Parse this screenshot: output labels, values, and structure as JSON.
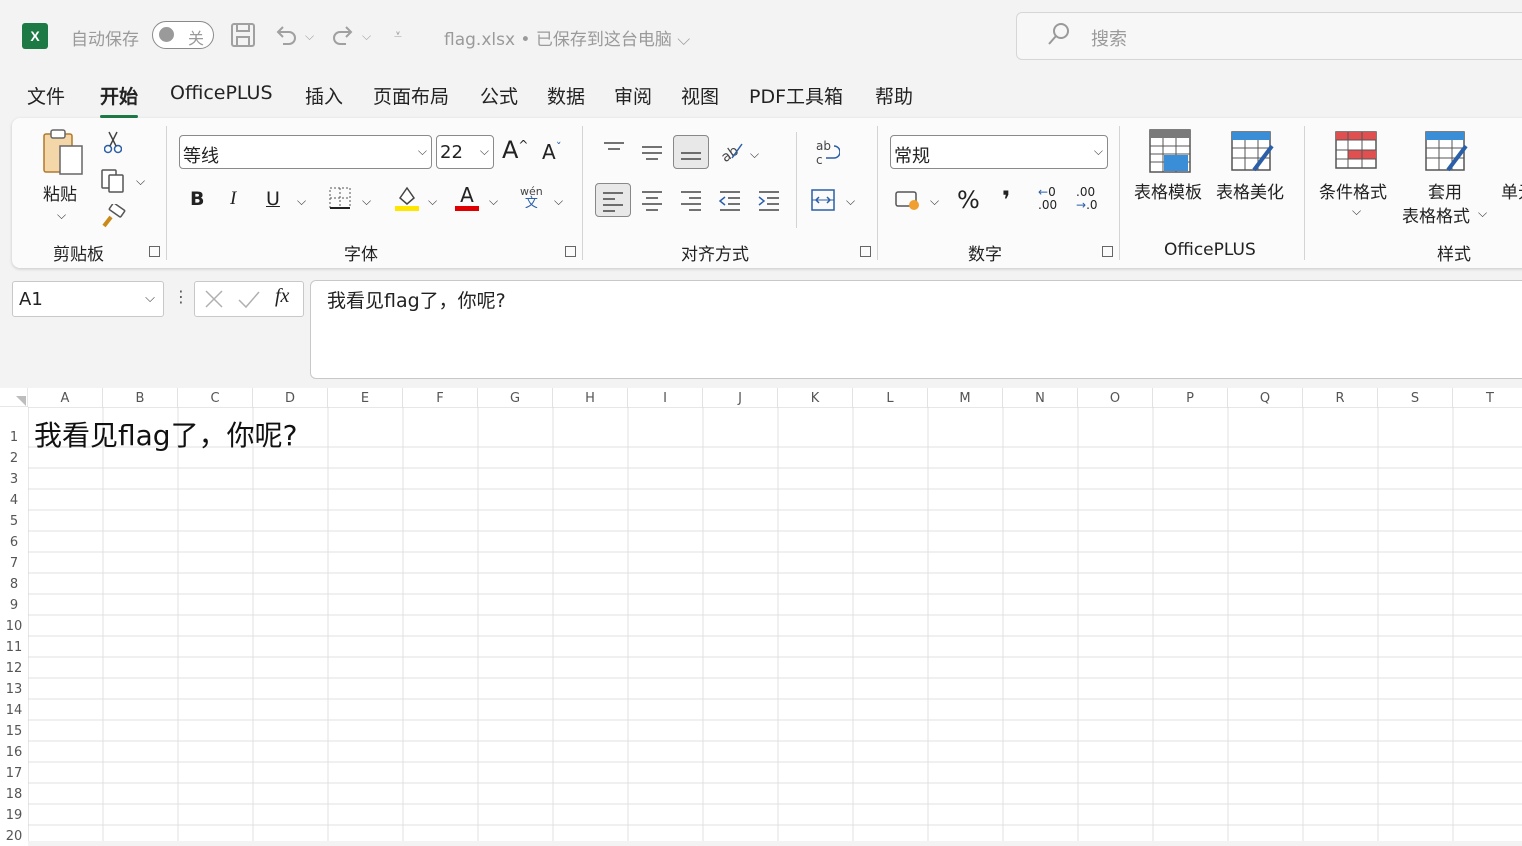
{
  "title_bar": {
    "app_logo_letter": "X",
    "autosave_label": "自动保存",
    "autosave_state": "关",
    "file_title": "flag.xlsx • 已保存到这台电脑",
    "search_placeholder": "搜索"
  },
  "tabs": [
    "文件",
    "开始",
    "OfficePLUS",
    "插入",
    "页面布局",
    "公式",
    "数据",
    "审阅",
    "视图",
    "PDF工具箱",
    "帮助"
  ],
  "active_tab": "开始",
  "ribbon": {
    "clipboard": {
      "label": "剪贴板",
      "paste_label": "粘贴"
    },
    "font": {
      "label": "字体",
      "font_name": "等线",
      "font_size": "22",
      "bold": "B",
      "italic": "I",
      "underline": "U",
      "font_color_glyph": "A",
      "phonetic_top": "wén",
      "phonetic_bottom": "文"
    },
    "alignment": {
      "label": "对齐方式"
    },
    "number": {
      "label": "数字",
      "format": "常规",
      "percent": "%",
      "comma": "❜",
      "inc_decimal": ".00",
      "dec_decimal": ".00"
    },
    "officeplus": {
      "label": "OfficePLUS",
      "table_template": "表格模板",
      "table_beautify": "表格美化"
    },
    "styles": {
      "label": "样式",
      "conditional_format": "条件格式",
      "apply_line1": "套用",
      "apply_line2": "表格格式",
      "cell_style": "单元"
    }
  },
  "formula_bar": {
    "name_box": "A1",
    "fx": "fx",
    "content": "我看见flag了，你呢?"
  },
  "sheet": {
    "columns": [
      "A",
      "B",
      "C",
      "D",
      "E",
      "F",
      "G",
      "H",
      "I",
      "J",
      "K",
      "L",
      "M",
      "N",
      "O",
      "P",
      "Q",
      "R",
      "S",
      "T"
    ],
    "rows": [
      "1",
      "2",
      "3",
      "4",
      "5",
      "6",
      "7",
      "8",
      "9",
      "10",
      "11",
      "12",
      "13",
      "14",
      "15",
      "16",
      "17",
      "18",
      "19",
      "20"
    ],
    "a1_value": "我看见flag了，你呢?"
  },
  "colors": {
    "excel_green": "#1d7a45",
    "font_color_bar": "#e00000",
    "highlight_bar": "#ffe600"
  }
}
